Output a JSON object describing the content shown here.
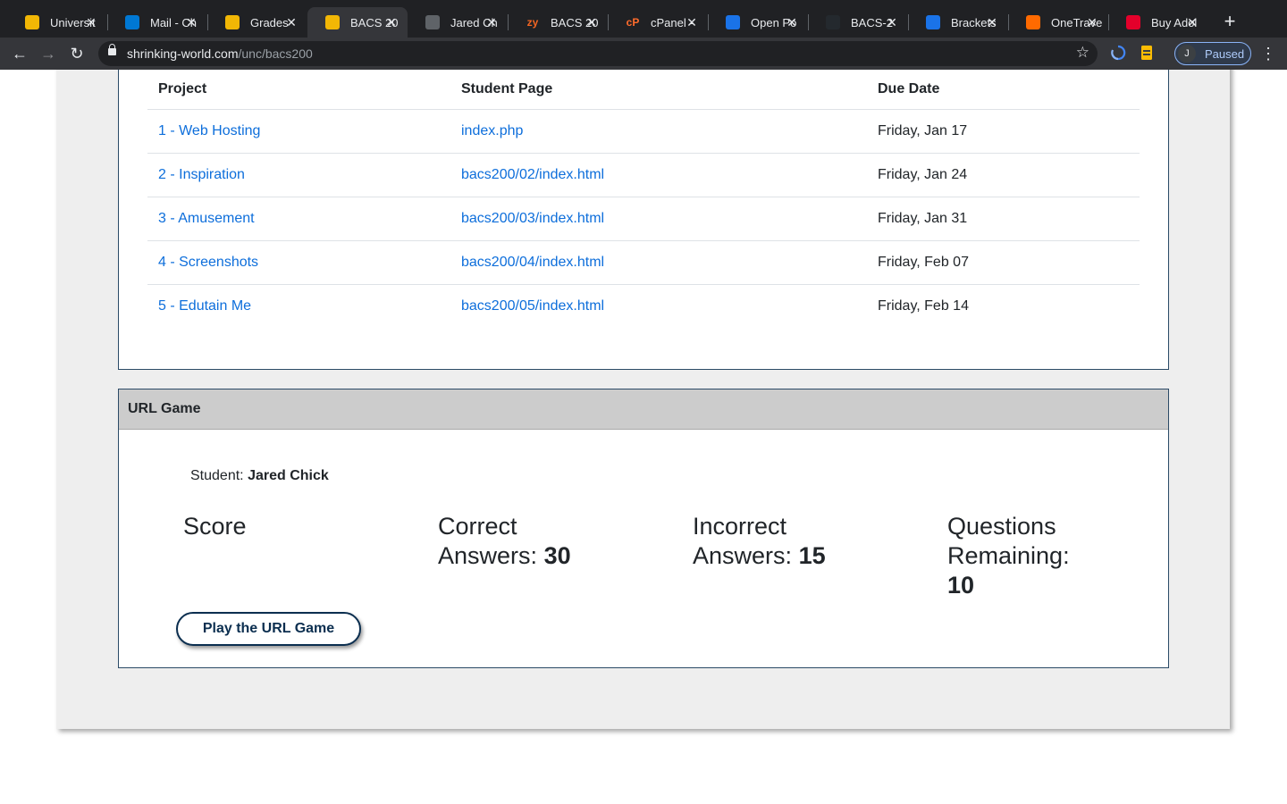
{
  "browser": {
    "tabs": [
      {
        "title": "Universit",
        "icon": "unc-bear-icon",
        "color": "#f2b705"
      },
      {
        "title": "Mail - Ch",
        "icon": "outlook-icon",
        "color": "#0078d4"
      },
      {
        "title": "Grades",
        "icon": "unc-bear-icon",
        "color": "#f2b705"
      },
      {
        "title": "BACS 20",
        "icon": "unc-bear-icon",
        "color": "#f2b705",
        "active": true
      },
      {
        "title": "Jared Ch",
        "icon": "globe-icon",
        "color": "#5f6368"
      },
      {
        "title": "BACS 20",
        "icon": "zybooks-icon",
        "color": "#f26522",
        "glyph": "zy"
      },
      {
        "title": "cPanel -",
        "icon": "cpanel-icon",
        "color": "#ff6c2c",
        "glyph": "cP"
      },
      {
        "title": "Open Po",
        "icon": "chart-icon",
        "color": "#1a73e8"
      },
      {
        "title": "BACS-2",
        "icon": "github-icon",
        "color": "#24292e"
      },
      {
        "title": "Brackets",
        "icon": "brackets-icon",
        "color": "#1a73e8"
      },
      {
        "title": "OneTrave",
        "icon": "map-pin-icon",
        "color": "#ff6a00"
      },
      {
        "title": "Buy Adol",
        "icon": "adobe-icon",
        "color": "#e4002b"
      }
    ],
    "url_host": "shrinking-world.com",
    "url_path": "/unc/bacs200",
    "profile_initial": "J",
    "profile_label": "Paused"
  },
  "projects": {
    "headers": [
      "Project",
      "Student Page",
      "Due Date"
    ],
    "rows": [
      {
        "project": "1 - Web Hosting",
        "page": "index.php",
        "due": "Friday, Jan 17"
      },
      {
        "project": "2 - Inspiration",
        "page": "bacs200/02/index.html",
        "due": "Friday, Jan 24"
      },
      {
        "project": "3 - Amusement",
        "page": "bacs200/03/index.html",
        "due": "Friday, Jan 31"
      },
      {
        "project": "4 - Screenshots",
        "page": "bacs200/04/index.html",
        "due": "Friday, Feb 07"
      },
      {
        "project": "5 - Edutain Me",
        "page": "bacs200/05/index.html",
        "due": "Friday, Feb 14"
      }
    ]
  },
  "url_game": {
    "header": "URL Game",
    "student_label": "Student:",
    "student_name": "Jared Chick",
    "score_label": "Score",
    "correct_label_1": "Correct",
    "correct_label_2": "Answers:",
    "correct_value": "30",
    "incorrect_label_1": "Incorrect",
    "incorrect_label_2": "Answers:",
    "incorrect_value": "15",
    "remaining_label_1": "Questions",
    "remaining_label_2": "Remaining:",
    "remaining_value": "10",
    "play_button": "Play the URL Game"
  }
}
